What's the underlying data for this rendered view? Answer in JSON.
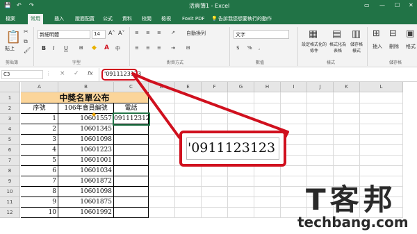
{
  "titlebar": {
    "file_title": "活頁簿1 - Excel",
    "help": "告訴我您想要執行的動作"
  },
  "tabs": [
    "檔案",
    "常用",
    "插入",
    "版面配置",
    "公式",
    "資料",
    "校閱",
    "檢視",
    "Foxit PDF"
  ],
  "ribbon": {
    "paste": "貼上",
    "clipboard": "剪貼簿",
    "font_name": "新細明體",
    "font_size": "14",
    "font_group": "字型",
    "wrap": "自動換列",
    "align_group": "對齊方式",
    "number_format": "文字",
    "number_group": "數值",
    "cond_format": "設定格式化的條件",
    "format_table": "格式化為表格",
    "cell_styles": "儲存格樣式",
    "styles_group": "樣式",
    "insert": "插入",
    "delete": "刪除",
    "format": "格式",
    "cells_group": "儲存格",
    "bold": "B",
    "italic": "I",
    "underline": "U"
  },
  "formula": {
    "name_box": "C3",
    "fx": "fx",
    "content": "'0911123123",
    "cancel": "×",
    "enter": "✓"
  },
  "columns": [
    "A",
    "B",
    "C",
    "D",
    "E",
    "F",
    "G",
    "H",
    "I",
    "J",
    "K",
    "L"
  ],
  "rows": [
    "1",
    "2",
    "3",
    "4",
    "5",
    "6",
    "7",
    "8",
    "9",
    "10",
    "11",
    "12"
  ],
  "table": {
    "title": "中獎名單公布",
    "headers": [
      "序號",
      "106年會員編號",
      "電話"
    ],
    "rows": [
      [
        "1",
        "10601557",
        "0911123123"
      ],
      [
        "2",
        "10601345",
        ""
      ],
      [
        "3",
        "10601098",
        ""
      ],
      [
        "4",
        "10601223",
        ""
      ],
      [
        "5",
        "10601001",
        ""
      ],
      [
        "6",
        "10601034",
        ""
      ],
      [
        "7",
        "10601872",
        ""
      ],
      [
        "8",
        "10601098",
        ""
      ],
      [
        "9",
        "10601875",
        ""
      ],
      [
        "10",
        "10601992",
        ""
      ]
    ]
  },
  "callout_text": "'0911123123",
  "watermark": {
    "logo": "T客邦",
    "site": "techbang.com"
  }
}
